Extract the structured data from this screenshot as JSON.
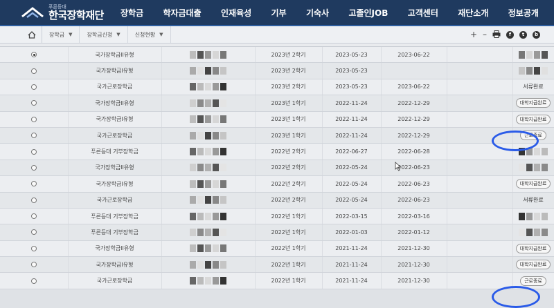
{
  "header": {
    "logo_sub": "푸른등대",
    "logo_name": "한국장학재단",
    "menu": [
      "장학금",
      "학자금대출",
      "인재육성",
      "기부",
      "기숙사",
      "고졸인JOB",
      "고객센터",
      "재단소개",
      "정보공개"
    ]
  },
  "subbar": {
    "crumbs": [
      "장학금",
      "장학금신청",
      "신청현황"
    ],
    "tools": [
      "+",
      "–",
      "print-icon",
      "facebook-icon",
      "twitter-icon",
      "blog-icon"
    ]
  },
  "table": {
    "rows": [
      {
        "selected": true,
        "name": "국가장학금II유형",
        "semester": "2023년 2학기",
        "start": "2023-05-23",
        "end": "2023-06-22",
        "status": "",
        "status_type": "blur"
      },
      {
        "selected": false,
        "name": "국가장학금I유형",
        "semester": "2023년 2학기",
        "start": "2023-05-23",
        "end": "",
        "status": "",
        "status_type": "blur"
      },
      {
        "selected": false,
        "name": "국가근로장학금",
        "semester": "2023년 2학기",
        "start": "2023-05-23",
        "end": "2023-06-22",
        "status": "서류완료",
        "status_type": "text"
      },
      {
        "selected": false,
        "name": "국가장학금II유형",
        "semester": "2023년 1학기",
        "start": "2022-11-24",
        "end": "2022-12-29",
        "status": "대학지급완료",
        "status_type": "badge"
      },
      {
        "selected": false,
        "name": "국가장학금I유형",
        "semester": "2023년 1학기",
        "start": "2022-11-24",
        "end": "2022-12-29",
        "status": "대학지급완료",
        "status_type": "badge"
      },
      {
        "selected": false,
        "name": "국가근로장학금",
        "semester": "2023년 1학기",
        "start": "2022-11-24",
        "end": "2022-12-29",
        "status": "근로종료",
        "status_type": "badge"
      },
      {
        "selected": false,
        "name": "푸른등대 기부장학금",
        "semester": "2022년 2학기",
        "start": "2022-06-27",
        "end": "2022-06-28",
        "status": "",
        "status_type": "blur"
      },
      {
        "selected": false,
        "name": "국가장학금II유형",
        "semester": "2022년 2학기",
        "start": "2022-05-24",
        "end": "2022-06-23",
        "status": "",
        "status_type": "blur"
      },
      {
        "selected": false,
        "name": "국가장학금I유형",
        "semester": "2022년 2학기",
        "start": "2022-05-24",
        "end": "2022-06-23",
        "status": "대학지급완료",
        "status_type": "badge"
      },
      {
        "selected": false,
        "name": "국가근로장학금",
        "semester": "2022년 2학기",
        "start": "2022-05-24",
        "end": "2022-06-23",
        "status": "서류완료",
        "status_type": "text"
      },
      {
        "selected": false,
        "name": "푸른등대 기부장학금",
        "semester": "2022년 1학기",
        "start": "2022-03-15",
        "end": "2022-03-16",
        "status": "",
        "status_type": "blur"
      },
      {
        "selected": false,
        "name": "푸른등대 기부장학금",
        "semester": "2022년 1학기",
        "start": "2022-01-03",
        "end": "2022-01-12",
        "status": "",
        "status_type": "blur"
      },
      {
        "selected": false,
        "name": "국가장학금II유형",
        "semester": "2022년 1학기",
        "start": "2021-11-24",
        "end": "2021-12-30",
        "status": "대학지급완료",
        "status_type": "badge"
      },
      {
        "selected": false,
        "name": "국가장학금I유형",
        "semester": "2022년 1학기",
        "start": "2021-11-24",
        "end": "2021-12-30",
        "status": "대학지급완료",
        "status_type": "badge"
      },
      {
        "selected": false,
        "name": "국가근로장학금",
        "semester": "2022년 1학기",
        "start": "2021-11-24",
        "end": "2021-12-30",
        "status": "근로종료",
        "status_type": "badge"
      }
    ]
  },
  "colors": {
    "nav_bg": "#1f3a5f",
    "highlight": "#2a5be8"
  }
}
